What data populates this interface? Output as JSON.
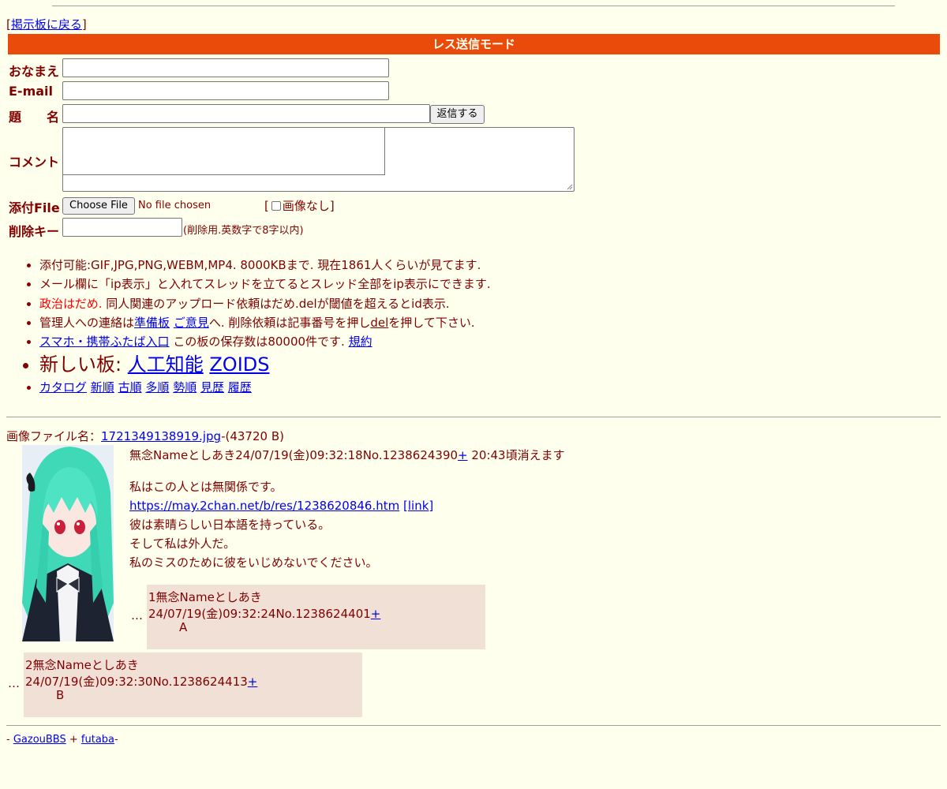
{
  "nav": {
    "back_open": "[",
    "back_link": "掲示板に戻る",
    "back_close": "]"
  },
  "form": {
    "mode_title": "レス送信モード",
    "name_label": "おなまえ",
    "email_label": "E-mail",
    "subject_label": "題　　名",
    "submit_label": "返信する",
    "comment_label": "コメント",
    "file_label": "添付File",
    "file_button": "Choose File",
    "file_status": "No file chosen",
    "noimage_open": "[",
    "noimage_label": "画像なし",
    "noimage_close": "]",
    "delkey_label": "削除キー",
    "delkey_note": "(削除用.英数字で8字以内)"
  },
  "rules": {
    "line1": "添付可能:GIF,JPG,PNG,WEBM,MP4. 8000KBまで. 現在1861人くらいが見てます.",
    "line2": "メール欄に「ip表示」と入れてスレッドを立てるとスレッド全部をip表示にできます.",
    "line3_red": "政治はだめ.",
    "line3_rest": " 同人関連のアップロード依頼はだめ.delが閾値を超えるとid表示.",
    "line4_a": "管理人への連絡は",
    "line4_link1": "準備板",
    "line4_link2": "ご意見",
    "line4_b": "へ. 削除依頼は記事番号を押し",
    "line4_link3": "del",
    "line4_c": "を押して下さい.",
    "line5_link": "スマホ・携帯ふたば入口",
    "line5_text": " この板の保存数は80000件です. ",
    "line5_link2": "規約",
    "line6_text": "新しい板: ",
    "line6_link1": "人工知能",
    "line6_link2": "ZOIDS",
    "line7_links": [
      "カタログ",
      "新順",
      "古順",
      "多順",
      "勢順",
      "見歴",
      "履歴"
    ]
  },
  "thread": {
    "file_label": "画像ファイル名：",
    "file_name": "1721349138919.jpg",
    "file_size": "-(43720 B)",
    "op_header": "無念Nameとしあき24/07/19(金)09:32:18No.1238624390",
    "op_plus": "+",
    "op_expire": " 20:43頃消えます",
    "op_line1": "私はこの人とは無関係です。",
    "op_link": "https://may.2chan.net/b/res/1238620846.htm",
    "op_link_tag": "[link]",
    "op_line3": "彼は素晴らしい日本語を持っている。",
    "op_line4": "そして私は外人だ。",
    "op_line5": "私のミスのために彼をいじめないでください。",
    "replies": [
      {
        "dots": "…",
        "header": "1無念Nameとしあき24/07/19(金)09:32:24No.1238624401",
        "plus": "+",
        "body": "A"
      },
      {
        "dots": "…",
        "header": "2無念Nameとしあき24/07/19(金)09:32:30No.1238624413",
        "plus": "+",
        "body": "B"
      }
    ]
  },
  "footer": {
    "prefix": "- ",
    "link1": "GazouBBS",
    "sep": " + ",
    "link2": "futaba",
    "suffix": "-"
  },
  "colors": {
    "background": "#ffffee",
    "text": "#800000",
    "header_bar": "#ea4a0a",
    "reply_bg": "#f0e0d6",
    "link": "#0000ee",
    "warning": "#ff0000"
  }
}
